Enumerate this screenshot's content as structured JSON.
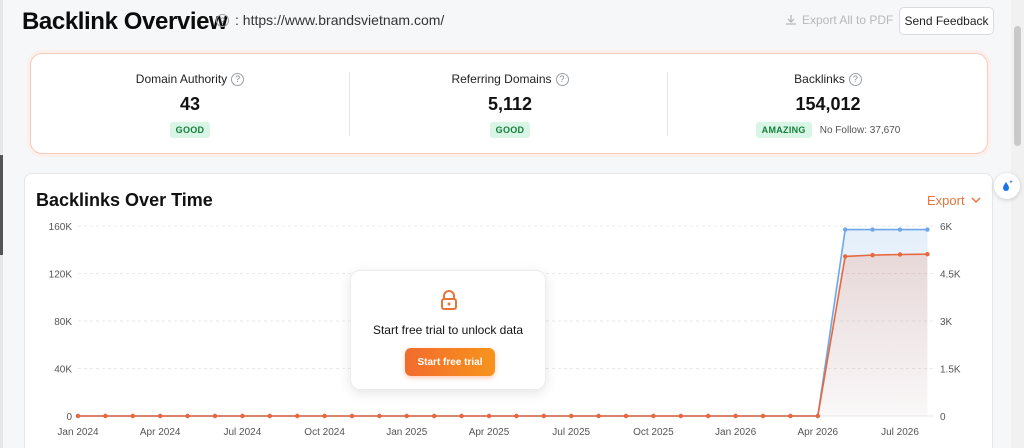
{
  "header": {
    "title": "Backlink Overview",
    "url": ": https://www.brandsvietnam.com/",
    "export_pdf_label": "Export All to PDF",
    "feedback_label": "Send Feedback"
  },
  "metrics": [
    {
      "label": "Domain Authority",
      "value": "43",
      "badge": "GOOD",
      "note": ""
    },
    {
      "label": "Referring Domains",
      "value": "5,112",
      "badge": "GOOD",
      "note": ""
    },
    {
      "label": "Backlinks",
      "value": "154,012",
      "badge": "AMAZING",
      "note": "No Follow: 37,670"
    }
  ],
  "chart_section": {
    "title": "Backlinks Over Time",
    "export_label": "Export",
    "lock_text": "Start free trial to unlock data",
    "trial_button": "Start free trial"
  },
  "colors": {
    "accent": "#e8743b",
    "blue_series": "#6fa8e8",
    "orange_series": "#e8673c",
    "badge_bg": "#d9f5e5",
    "badge_text": "#15803d"
  },
  "chart_data": {
    "type": "line",
    "x_tick_labels": [
      "Jan 2024",
      "Apr 2024",
      "Jul 2024",
      "Oct 2024",
      "Jan 2025",
      "Apr 2025",
      "Jul 2025",
      "Oct 2025",
      "Jan 2026",
      "Apr 2026",
      "Jul 2026"
    ],
    "y_left_ticks": [
      "0",
      "40K",
      "80K",
      "120K",
      "160K"
    ],
    "y_right_ticks": [
      "0",
      "1.5K",
      "3K",
      "4.5K",
      "6K"
    ],
    "ylim_left": [
      0,
      160000
    ],
    "ylim_right": [
      0,
      6000
    ],
    "months": [
      "2024-01",
      "2024-02",
      "2024-03",
      "2024-04",
      "2024-05",
      "2024-06",
      "2024-07",
      "2024-08",
      "2024-09",
      "2024-10",
      "2024-11",
      "2024-12",
      "2025-01",
      "2025-02",
      "2025-03",
      "2025-04",
      "2025-05",
      "2025-06",
      "2025-07",
      "2025-08",
      "2025-09",
      "2025-10",
      "2025-11",
      "2025-12",
      "2026-01",
      "2026-02",
      "2026-03",
      "2026-04",
      "2026-05",
      "2026-06",
      "2026-07",
      "2026-08"
    ],
    "series": [
      {
        "axis": "left",
        "color": "#6fa8e8",
        "values": [
          0,
          0,
          0,
          0,
          0,
          0,
          0,
          0,
          0,
          0,
          0,
          0,
          0,
          0,
          0,
          0,
          0,
          0,
          0,
          0,
          0,
          0,
          0,
          0,
          0,
          0,
          0,
          0,
          157000,
          157000,
          157000,
          157000
        ]
      },
      {
        "axis": "right",
        "color": "#e8673c",
        "values": [
          0,
          0,
          0,
          0,
          0,
          0,
          0,
          0,
          0,
          0,
          0,
          0,
          0,
          0,
          0,
          0,
          0,
          0,
          0,
          0,
          0,
          0,
          0,
          0,
          0,
          0,
          0,
          0,
          5040,
          5080,
          5100,
          5110
        ]
      }
    ],
    "grid": true
  }
}
